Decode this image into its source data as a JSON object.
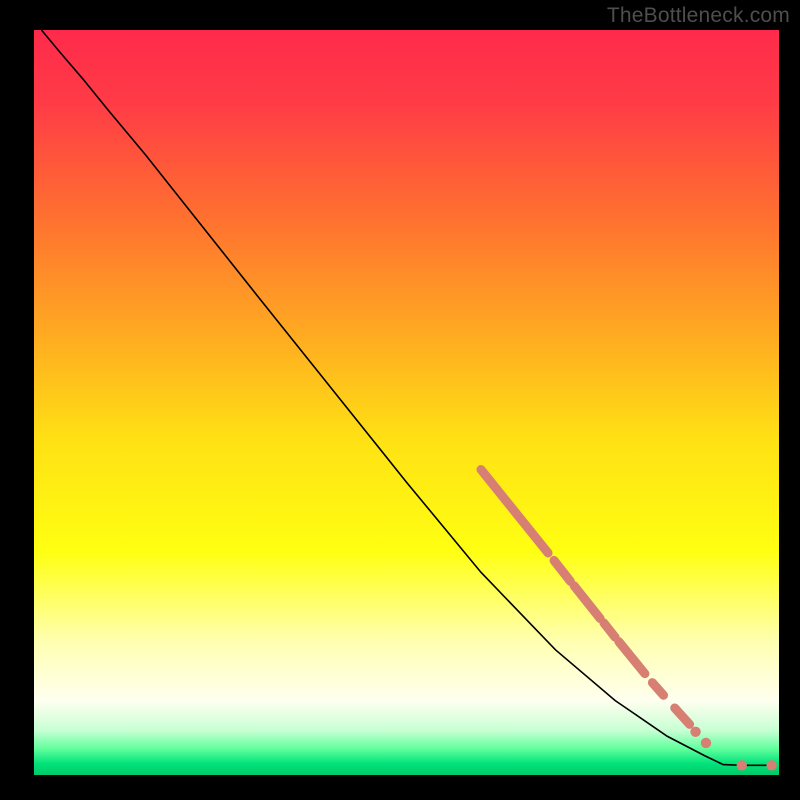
{
  "watermark": "TheBottleneck.com",
  "chart_data": {
    "type": "line",
    "title": "",
    "xlabel": "",
    "ylabel": "",
    "xlim": [
      0,
      100
    ],
    "ylim": [
      0,
      100
    ],
    "background_gradient_stops": [
      {
        "offset": 0.0,
        "color": "#ff2a4b"
      },
      {
        "offset": 0.1,
        "color": "#ff3c46"
      },
      {
        "offset": 0.25,
        "color": "#ff7030"
      },
      {
        "offset": 0.4,
        "color": "#ffa722"
      },
      {
        "offset": 0.55,
        "color": "#ffe114"
      },
      {
        "offset": 0.7,
        "color": "#ffff12"
      },
      {
        "offset": 0.82,
        "color": "#ffffb0"
      },
      {
        "offset": 0.9,
        "color": "#ffffef"
      },
      {
        "offset": 0.94,
        "color": "#c8ffd4"
      },
      {
        "offset": 0.965,
        "color": "#60ff9c"
      },
      {
        "offset": 0.985,
        "color": "#00e27a"
      },
      {
        "offset": 1.0,
        "color": "#00c968"
      }
    ],
    "series": [
      {
        "name": "curve",
        "color": "#000000",
        "width": 1.6,
        "points": [
          {
            "x": 1.0,
            "y": 100.0
          },
          {
            "x": 3.5,
            "y": 97.0
          },
          {
            "x": 6.5,
            "y": 93.5
          },
          {
            "x": 10.0,
            "y": 89.2
          },
          {
            "x": 15.0,
            "y": 83.2
          },
          {
            "x": 20.0,
            "y": 76.9
          },
          {
            "x": 30.0,
            "y": 64.3
          },
          {
            "x": 40.0,
            "y": 51.8
          },
          {
            "x": 50.0,
            "y": 39.3
          },
          {
            "x": 60.0,
            "y": 27.2
          },
          {
            "x": 70.0,
            "y": 16.8
          },
          {
            "x": 78.0,
            "y": 10.0
          },
          {
            "x": 85.0,
            "y": 5.2
          },
          {
            "x": 90.0,
            "y": 2.6
          },
          {
            "x": 92.5,
            "y": 1.4
          },
          {
            "x": 95.0,
            "y": 1.3
          },
          {
            "x": 97.5,
            "y": 1.3
          },
          {
            "x": 99.0,
            "y": 1.3
          }
        ]
      },
      {
        "name": "highlight-segments",
        "color": "#d77f72",
        "width": 9,
        "segments": [
          [
            {
              "x": 60.0,
              "y": 41.0
            },
            {
              "x": 69.0,
              "y": 29.8
            }
          ],
          [
            {
              "x": 69.8,
              "y": 28.8
            },
            {
              "x": 72.0,
              "y": 26.0
            }
          ],
          [
            {
              "x": 72.5,
              "y": 25.4
            },
            {
              "x": 76.0,
              "y": 21.0
            }
          ],
          [
            {
              "x": 76.5,
              "y": 20.4
            },
            {
              "x": 78.0,
              "y": 18.5
            }
          ],
          [
            {
              "x": 78.5,
              "y": 17.9
            },
            {
              "x": 82.0,
              "y": 13.6
            }
          ],
          [
            {
              "x": 83.0,
              "y": 12.4
            },
            {
              "x": 84.5,
              "y": 10.7
            }
          ],
          [
            {
              "x": 86.0,
              "y": 9.0
            },
            {
              "x": 88.0,
              "y": 6.8
            }
          ]
        ]
      },
      {
        "name": "highlight-dots",
        "color": "#d77f72",
        "radius": 5.2,
        "points": [
          {
            "x": 88.8,
            "y": 5.8
          },
          {
            "x": 90.2,
            "y": 4.3
          },
          {
            "x": 95.0,
            "y": 1.3
          },
          {
            "x": 99.0,
            "y": 1.3
          }
        ]
      }
    ]
  }
}
